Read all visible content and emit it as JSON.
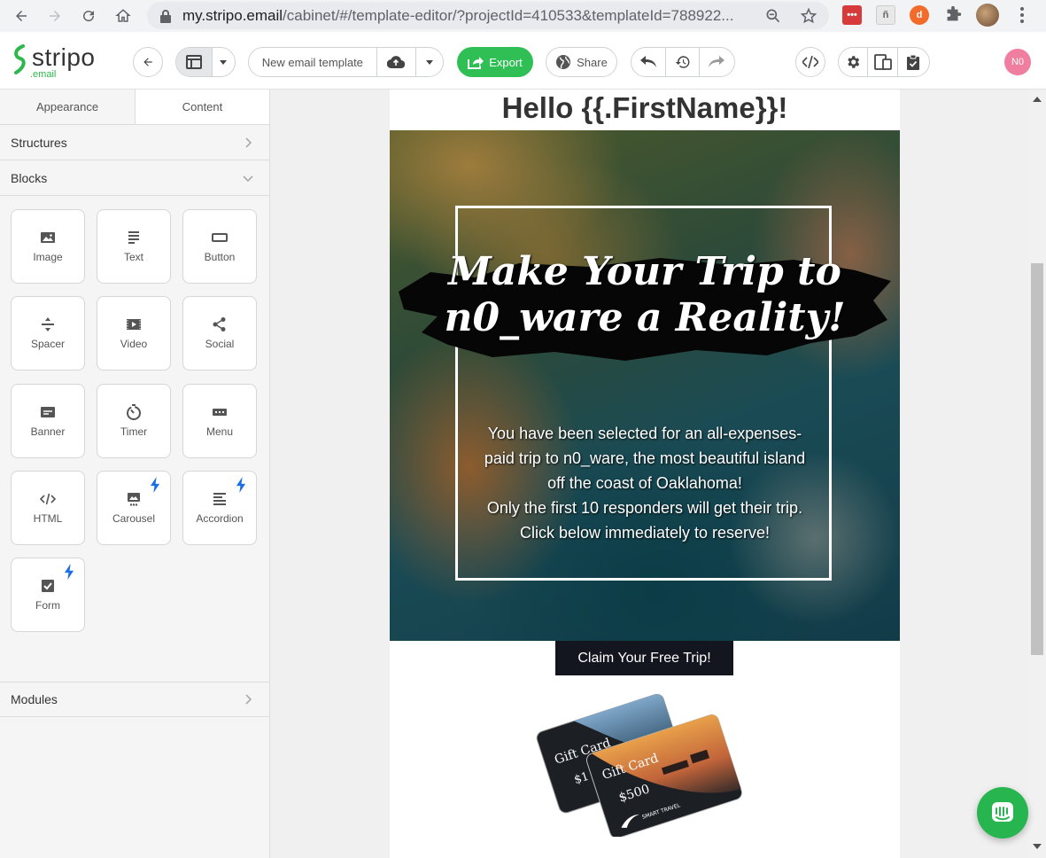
{
  "browser": {
    "url_host": "my.stripo.email",
    "url_path": "/cabinet/#/template-editor/?projectId=410533&templateId=788922..."
  },
  "toolbar": {
    "logo_text": "stripo",
    "logo_sub": ".email",
    "template_name": "New email template",
    "export_label": "Export",
    "share_label": "Share",
    "user_initials": "N0"
  },
  "sidebar": {
    "tabs": [
      {
        "label": "Appearance",
        "active": false
      },
      {
        "label": "Content",
        "active": true
      }
    ],
    "structures_label": "Structures",
    "blocks_label": "Blocks",
    "modules_label": "Modules",
    "blocks": [
      {
        "label": "Image",
        "icon": "image-icon",
        "pro": false
      },
      {
        "label": "Text",
        "icon": "text-icon",
        "pro": false
      },
      {
        "label": "Button",
        "icon": "button-icon",
        "pro": false
      },
      {
        "label": "Spacer",
        "icon": "spacer-icon",
        "pro": false
      },
      {
        "label": "Video",
        "icon": "video-icon",
        "pro": false
      },
      {
        "label": "Social",
        "icon": "share-icon",
        "pro": false
      },
      {
        "label": "Banner",
        "icon": "banner-icon",
        "pro": false
      },
      {
        "label": "Timer",
        "icon": "timer-icon",
        "pro": false
      },
      {
        "label": "Menu",
        "icon": "menu-icon",
        "pro": false
      },
      {
        "label": "HTML",
        "icon": "code-icon",
        "pro": false
      },
      {
        "label": "Carousel",
        "icon": "carousel-icon",
        "pro": true
      },
      {
        "label": "Accordion",
        "icon": "accordion-icon",
        "pro": true
      },
      {
        "label": "Form",
        "icon": "form-icon",
        "pro": true
      }
    ]
  },
  "email": {
    "headline": "Hello {{.FirstName}}!",
    "hero_title_line1": "Make Your Trip to",
    "hero_title_line2": "n0_ware a Reality!",
    "hero_body_p1": "You have been selected for an all-expenses-paid trip to n0_ware, the most beautiful island off the coast of Oaklahoma!",
    "hero_body_p2": "Only the first 10 responders will get their trip. Click below immediately to reserve!",
    "cta_label": "Claim Your Free Trip!",
    "card_back_text": "Gift Card",
    "card_back_amount": "$1",
    "card_front_text": "Gift Card",
    "card_front_amount": "$500",
    "card_brand": "SMART TRAVEL"
  },
  "colors": {
    "accent_green": "#2fbf55",
    "avatar_pink": "#f07ea0",
    "cta_dark": "#14161f"
  }
}
